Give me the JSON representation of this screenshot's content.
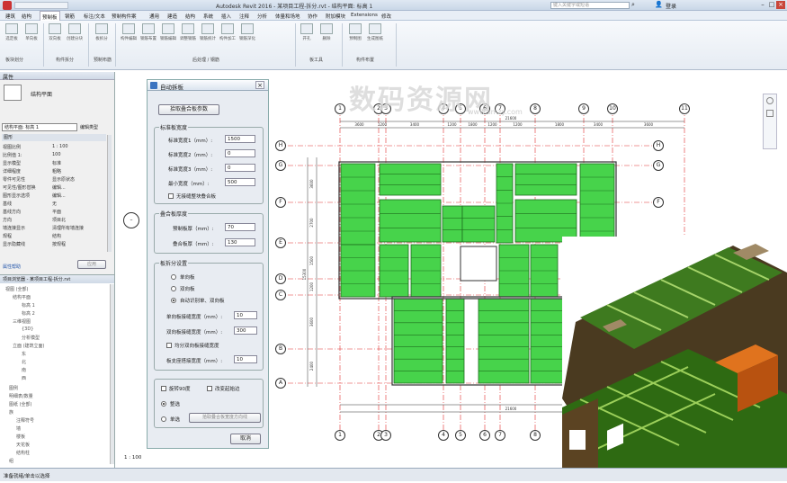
{
  "titlebar": {
    "title": "Autodesk Revit 2016 -   某项目工程-拆分.rvt - 结构平面: 标高 1",
    "search_placeholder": "键入关键字或短语",
    "user": "登录"
  },
  "menu": [
    "建筑",
    "结构",
    "预制板",
    "钢筋",
    "标注/文本",
    "预制构件案",
    "通用",
    "建造",
    "结构",
    "系统",
    "插入",
    "注释",
    "分析",
    "体量和场地",
    "协作",
    "附加模块",
    "修改"
  ],
  "menu_extra": "Extensions",
  "ribbon": {
    "groups": [
      "板块划分",
      "构件拆分",
      "预制布筋",
      "后处理 / 钢筋",
      "板工具",
      "构件布置"
    ],
    "buttons": [
      "选定板",
      "单向板",
      "双向板",
      "创建分块",
      "板拆分",
      "构件编辑",
      "钢筋布置",
      "钢筋编辑",
      "调整钢筋",
      "钢筋统计",
      "构件加工",
      "钢筋深化",
      "开孔",
      "删除",
      "预制图",
      "生成图纸",
      "图纸合并"
    ]
  },
  "props": {
    "header": "属性",
    "type_name": "结构平面",
    "selector": "结构平面: 标高 1",
    "edit_type": "编辑类型",
    "section": "图形",
    "rows": [
      {
        "k": "视图比例",
        "v": "1 : 100"
      },
      {
        "k": "比例值 1:",
        "v": "100"
      },
      {
        "k": "显示模型",
        "v": "标准"
      },
      {
        "k": "详细程度",
        "v": "粗略"
      },
      {
        "k": "零件可见性",
        "v": "显示原状态"
      },
      {
        "k": "可见性/图形替换",
        "v": "编辑..."
      },
      {
        "k": "图形显示选项",
        "v": "编辑..."
      },
      {
        "k": "基线",
        "v": "无"
      },
      {
        "k": "基线方向",
        "v": "平面"
      },
      {
        "k": "方向",
        "v": "项目北"
      },
      {
        "k": "墙连接显示",
        "v": "清理所有墙连接"
      },
      {
        "k": "规程",
        "v": "结构"
      },
      {
        "k": "显示隐藏线",
        "v": "按规程"
      }
    ],
    "help": "属性帮助",
    "apply": "应用"
  },
  "browser": {
    "header": "项目浏览器 - 某项目工程-拆分.rvt",
    "items": [
      "视图 (全部)",
      "结构平面",
      "标高 1",
      "标高 2",
      "三维视图",
      "{3D}",
      "分析模型",
      "立面 (建筑立面)",
      "东",
      "北",
      "南",
      "西",
      "图例",
      "明细表/数量",
      "图纸 (全部)",
      "族",
      "注释符号",
      "墙",
      "楼板",
      "天花板",
      "结构柱",
      "组"
    ]
  },
  "dialog": {
    "title": "自动拆板",
    "pick_button": "拾取叠合板参数",
    "std_group": "标准板宽度",
    "width1_label": "标准宽度1（mm）:",
    "width1": "1500",
    "width2_label": "标准宽度2（mm）:",
    "width2": "0",
    "width3_label": "标准宽度3（mm）:",
    "width3": "0",
    "min_label": "最小宽度（mm）:",
    "min": "500",
    "no_seam": "无接缝整块叠合板",
    "thick_group": "叠合板厚度",
    "precast_label": "预制板厚（mm）:",
    "precast": "70",
    "total_label": "叠合板厚（mm）:",
    "total": "130",
    "split_group": "板拆分设置",
    "opt_one": "单向板",
    "opt_two": "双向板",
    "opt_auto": "自动识别单、双向板",
    "one_seam_label": "单向板接缝宽度（mm）:",
    "one_seam": "10",
    "two_seam_label": "双向板接缝宽度（mm）:",
    "two_seam": "300",
    "avg_label": "均分双向板接缝宽度",
    "support_label": "板支座搭接宽度（mm）:",
    "support": "10",
    "rotate_label": "旋转90度",
    "change_start_label": "改变起始边",
    "all_label": "整选",
    "single_label": "单选",
    "pick_dir_button": "拾取叠合板宽度方向线",
    "cancel_button": "取消"
  },
  "grid": {
    "cols": [
      "1",
      "2",
      "3",
      "4",
      "5",
      "6",
      "7",
      "8",
      "9",
      "10",
      "11"
    ],
    "rows": [
      "H",
      "G",
      "F",
      "E",
      "D",
      "C",
      "B",
      "A"
    ],
    "dims_top": [
      "3600",
      "1200",
      "3400",
      "1200",
      "1800",
      "1200",
      "1200",
      "1800",
      "3400",
      "3600"
    ],
    "total": "21600",
    "left_dims": [
      "3600",
      "2700",
      "1500",
      "1200",
      "3600",
      "2400"
    ],
    "left_total": "15300"
  },
  "status": {
    "scale": "1 : 100",
    "hint": "准备就绪/单击以选择"
  },
  "watermark": {
    "main": "数码资源网",
    "sub": "www.smzy.com"
  },
  "colors": {
    "slab": "#47d34b",
    "axis": "#e03030"
  }
}
